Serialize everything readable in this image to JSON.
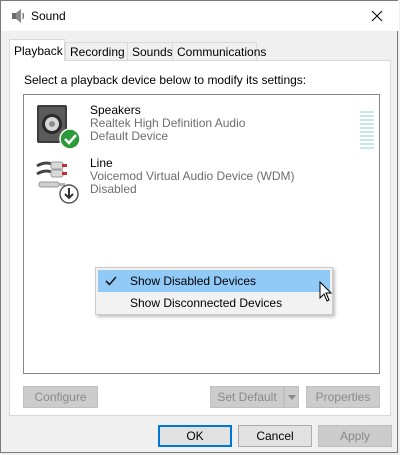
{
  "window": {
    "title": "Sound",
    "icon": "speaker-icon"
  },
  "tabs": [
    {
      "label": "Playback",
      "active": true
    },
    {
      "label": "Recording"
    },
    {
      "label": "Sounds"
    },
    {
      "label": "Communications"
    }
  ],
  "instruction": "Select a playback device below to modify its settings:",
  "devices": [
    {
      "name": "Speakers",
      "description": "Realtek High Definition Audio",
      "status": "Default Device",
      "icon": "speakers-icon",
      "badge": "default-check-icon"
    },
    {
      "name": "Line",
      "description": "Voicemod Virtual Audio Device (WDM)",
      "status": "Disabled",
      "icon": "line-cable-icon",
      "badge": "disabled-arrow-icon"
    }
  ],
  "context_menu": {
    "items": [
      {
        "label": "Show Disabled Devices",
        "checked": true
      },
      {
        "label": "Show Disconnected Devices",
        "checked": false
      }
    ]
  },
  "panel_buttons": {
    "configure": "Configure",
    "set_default": "Set Default",
    "properties": "Properties"
  },
  "dialog_buttons": {
    "ok": "OK",
    "cancel": "Cancel",
    "apply": "Apply"
  },
  "colors": {
    "accent": "#0078d7",
    "menu_highlight": "#91c9f7",
    "check_badge": "#2d9a3a"
  }
}
